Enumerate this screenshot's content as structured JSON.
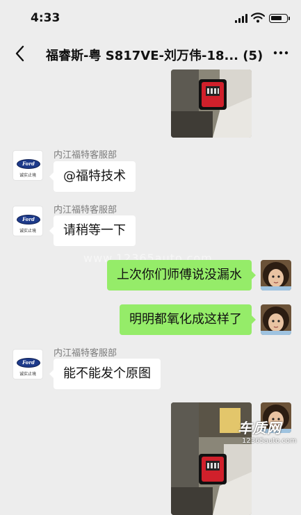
{
  "status_bar": {
    "time": "4:33"
  },
  "nav": {
    "title": "福睿斯-粤 S817VE-刘万伟-18... (5)"
  },
  "messages": {
    "m1": {
      "sender": "内江福特客服部",
      "text": "@福特技术"
    },
    "m2": {
      "sender": "内江福特客服部",
      "text": "请稍等一下"
    },
    "m3": {
      "text": "上次你们师傅说没漏水"
    },
    "m4": {
      "text": "明明都氧化成这样了"
    },
    "m5": {
      "sender": "内江福特客服部",
      "text": "能不能发个原图"
    }
  },
  "ford_avatar": {
    "brand": "Ford",
    "sub": "诚实止境"
  },
  "watermark": "www.12365auto.com",
  "site_logo": {
    "cn": "车质网",
    "en": "12365auto.com"
  },
  "colors": {
    "bg": "#ededed",
    "bubble_out": "#95ec69",
    "bubble_in": "#ffffff",
    "ford_blue": "#1d3a8a"
  }
}
